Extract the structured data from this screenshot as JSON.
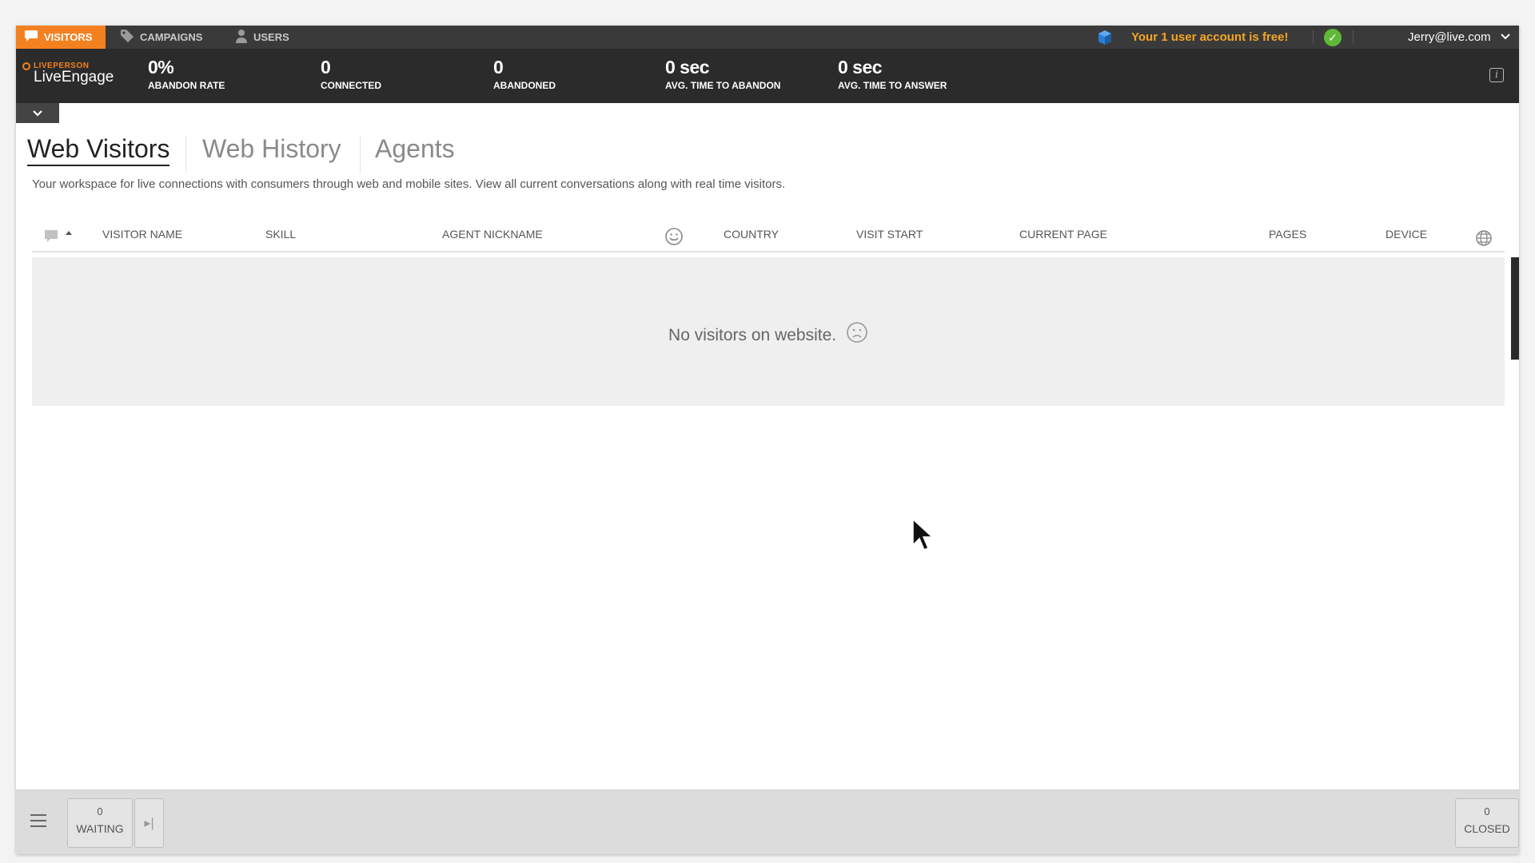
{
  "nav": {
    "tabs": [
      {
        "label": "Visitors",
        "icon": "chat-bubble-icon"
      },
      {
        "label": "Campaigns",
        "icon": "tag-icon"
      },
      {
        "label": "Users",
        "icon": "user-icon"
      }
    ],
    "promo": "Your 1 user account is free!",
    "user_email": "Jerry@live.com"
  },
  "logo": {
    "brand": "LIVEPERSON",
    "product": "LiveEngage"
  },
  "stats": [
    {
      "value": "0%",
      "label": "Abandon Rate"
    },
    {
      "value": "0",
      "label": "Connected"
    },
    {
      "value": "0",
      "label": "Abandoned"
    },
    {
      "value": "0 sec",
      "label": "Avg. Time to Abandon"
    },
    {
      "value": "0 sec",
      "label": "Avg. Time to Answer"
    }
  ],
  "page": {
    "tabs": [
      "Web Visitors",
      "Web History",
      "Agents"
    ],
    "description": "Your workspace for live connections with consumers through web and mobile sites. View all current conversations along with real time visitors."
  },
  "table": {
    "columns": [
      "Visitor Name",
      "Skill",
      "Agent Nickname",
      "Country",
      "Visit Start",
      "Current Page",
      "Pages",
      "Device"
    ],
    "empty_message": "No visitors on website."
  },
  "bottom": {
    "waiting": {
      "count": "0",
      "label": "Waiting"
    },
    "closed": {
      "count": "0",
      "label": "Closed"
    }
  },
  "colors": {
    "accent": "#f48120",
    "promo": "#f5a623",
    "status_ok": "#5fb936"
  }
}
